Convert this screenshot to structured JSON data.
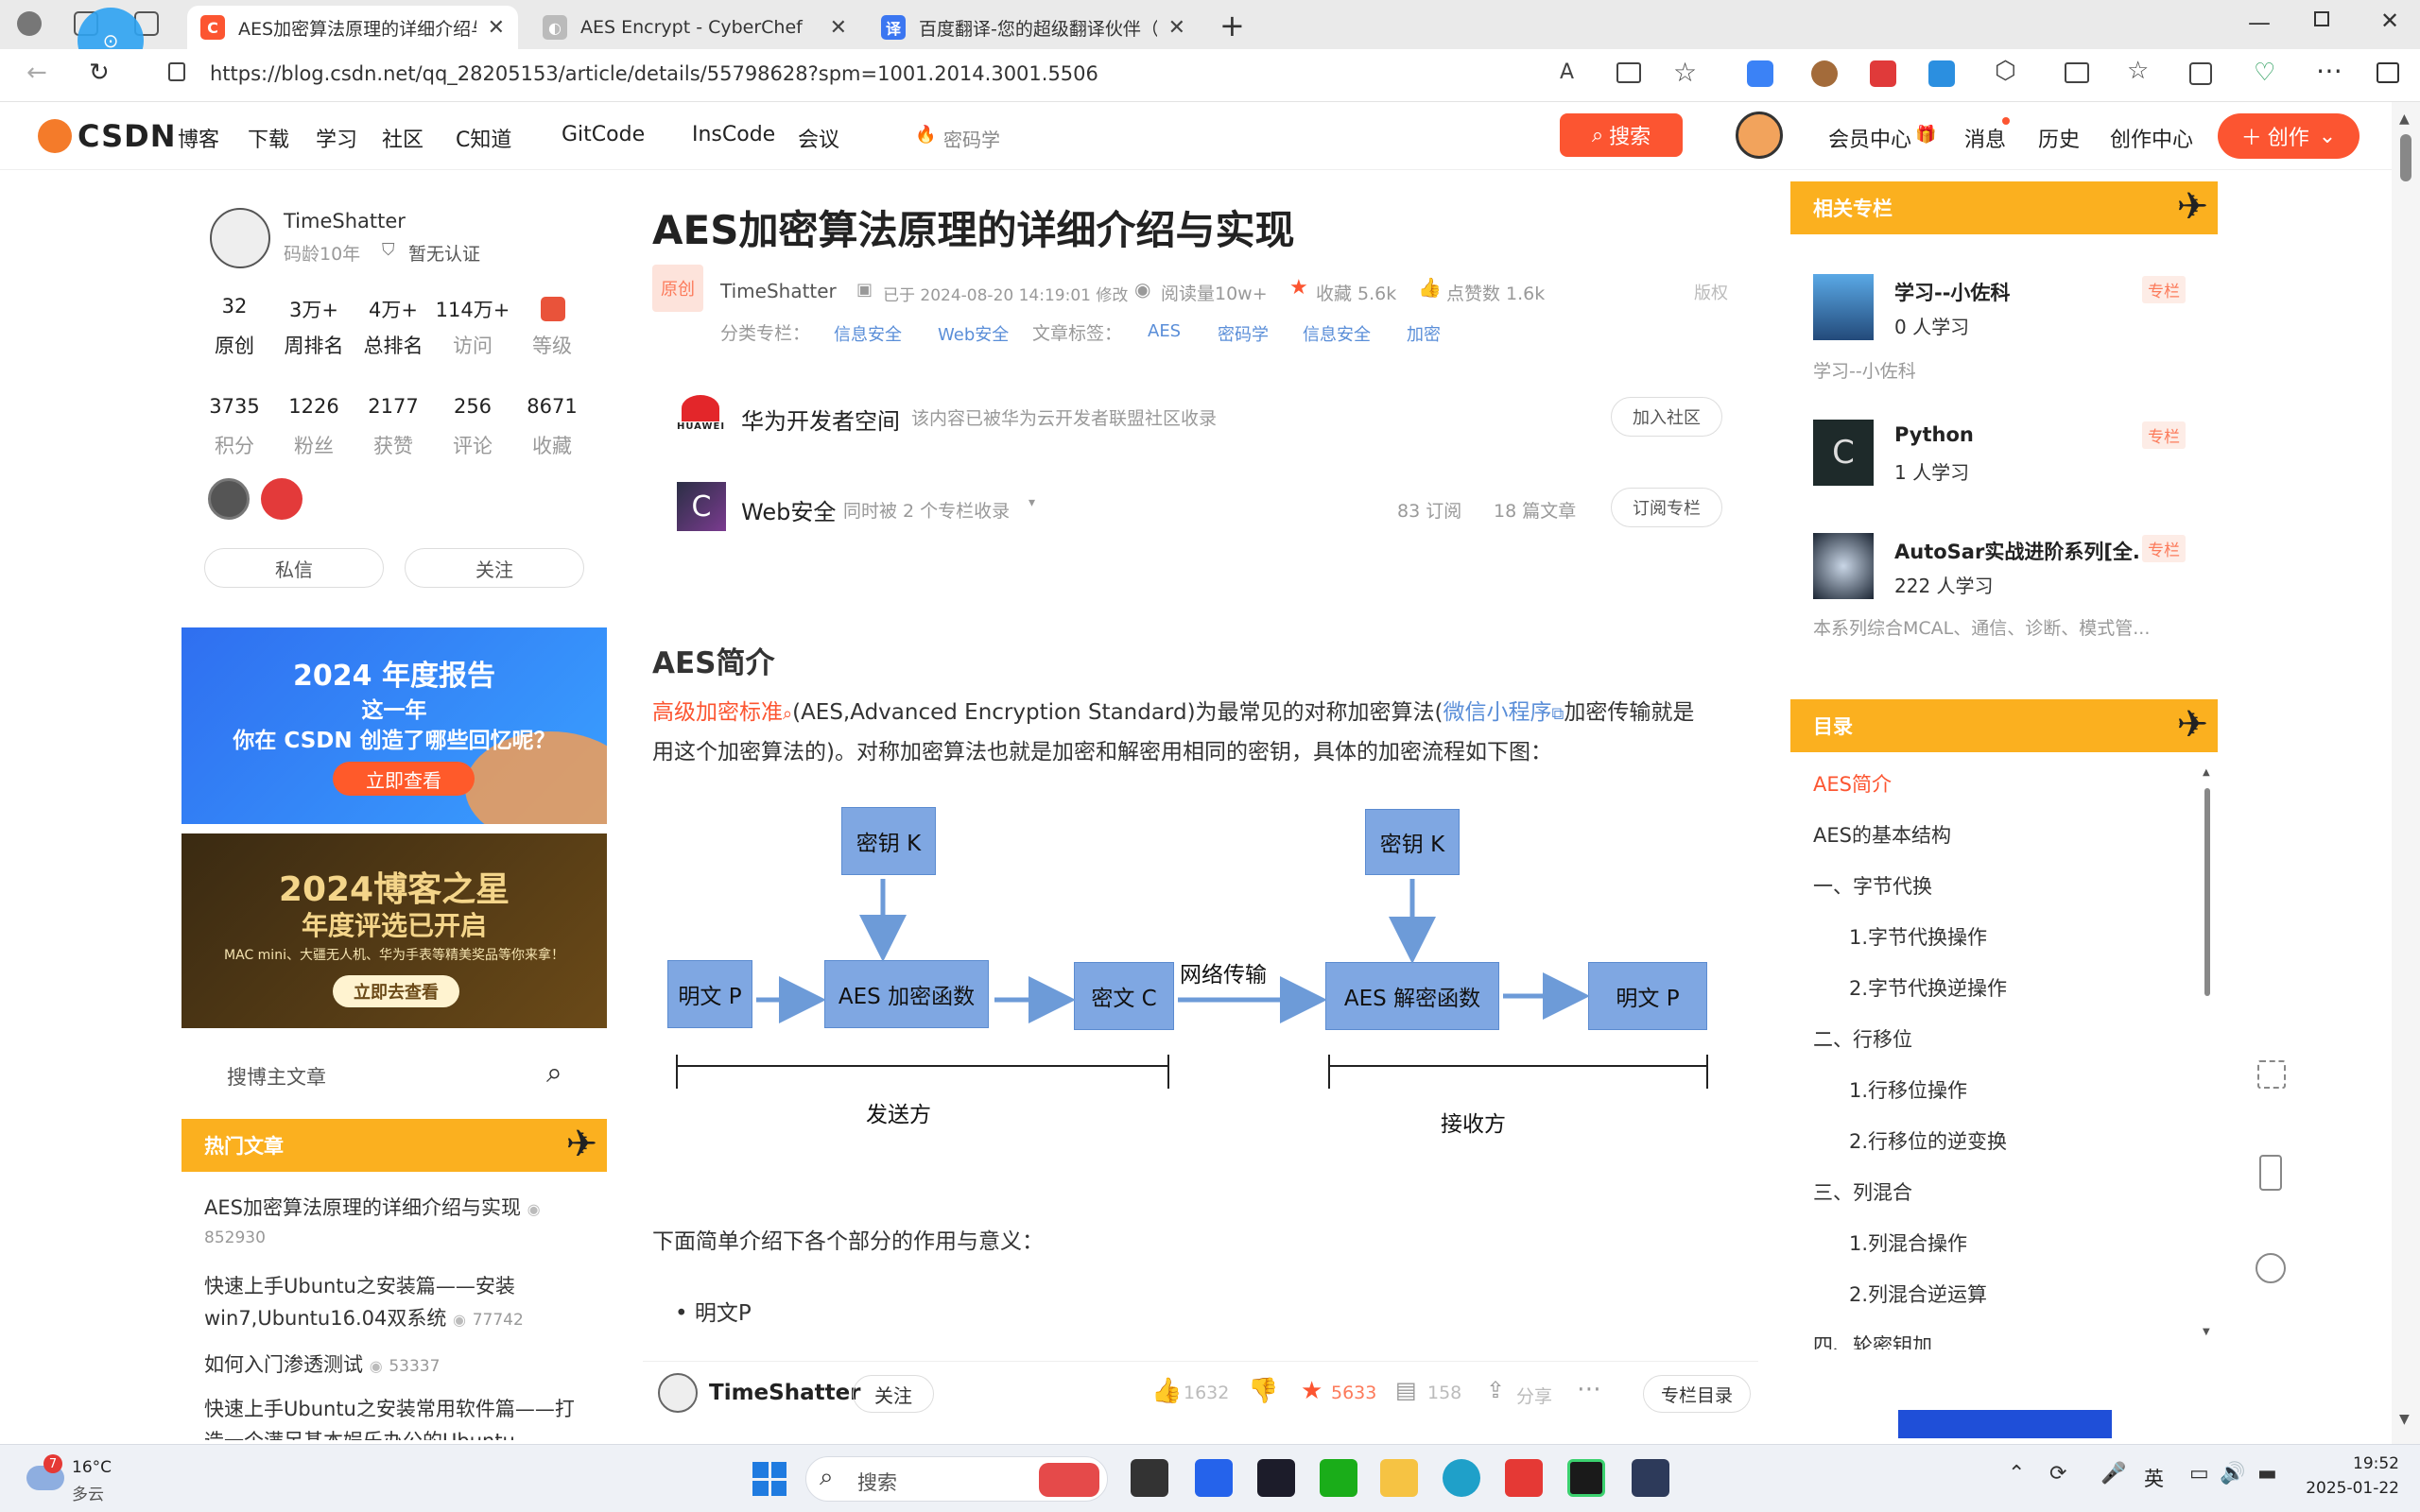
{
  "browser": {
    "tabs": [
      {
        "title": "AES加密算法原理的详细介绍与实",
        "icon": "C",
        "color": "#fc5531"
      },
      {
        "title": "AES Encrypt - CyberChef",
        "icon": "◐",
        "color": "#aaa"
      },
      {
        "title": "百度翻译-您的超级翻译伙伴（文",
        "icon": "译",
        "color": "#3b76f1"
      }
    ],
    "url": "https://blog.csdn.net/qq_28205153/article/details/55798628?spm=1001.2014.3001.5506"
  },
  "nav": {
    "logo": "CSDN",
    "items": [
      "博客",
      "下载",
      "学习",
      "社区",
      "C知道",
      "GitCode",
      "InsCode",
      "会议"
    ],
    "search_placeholder": "密码学",
    "search_button": "搜索",
    "right_items": [
      "会员中心",
      "消息",
      "历史",
      "创作中心"
    ],
    "create_button": "创作"
  },
  "author": {
    "name": "TimeShatter",
    "age": "码龄10年",
    "cert": "暂无认证",
    "stats1": [
      {
        "num": "32",
        "label": "原创"
      },
      {
        "num": "3万+",
        "label": "周排名"
      },
      {
        "num": "4万+",
        "label": "总排名"
      },
      {
        "num": "114万+",
        "label": "访问"
      },
      {
        "num": "",
        "label": "等级"
      }
    ],
    "stats2": [
      {
        "num": "3735",
        "label": "积分"
      },
      {
        "num": "1226",
        "label": "粉丝"
      },
      {
        "num": "2177",
        "label": "获赞"
      },
      {
        "num": "256",
        "label": "评论"
      },
      {
        "num": "8671",
        "label": "收藏"
      }
    ],
    "message_button": "私信",
    "follow_button": "关注"
  },
  "banners": {
    "report_line1": "2024 年度报告",
    "report_line2": "这一年",
    "report_line3": "你在 CSDN 创造了哪些回忆呢？",
    "report_btn": "立即查看",
    "star_line1": "2024博客之星",
    "star_line2": "年度评选已开启",
    "star_line3": "MAC mini、大疆无人机、华为手表等精美奖品等你来拿！",
    "star_btn": "立即去查看"
  },
  "blog_search_placeholder": "搜博主文章",
  "hot": {
    "title": "热门文章",
    "items": [
      {
        "title": "AES加密算法原理的详细介绍与实现",
        "views": "852930"
      },
      {
        "title": "快速上手Ubuntu之安装篇——安装win7,Ubuntu16.04双系统",
        "views": "77742"
      },
      {
        "title": "如何入门渗透测试",
        "views": "53337"
      },
      {
        "title": "快速上手Ubuntu之安装常用软件篇——打造一个满足基本娱乐办公的Ubuntu",
        "views": ""
      }
    ]
  },
  "article": {
    "title": "AES加密算法原理的详细介绍与实现",
    "badge": "原创",
    "author": "TimeShatter",
    "date": "已于 2024-08-20 14:19:01 修改",
    "reads": "阅读量10w+",
    "favs": "收藏 5.6k",
    "likes": "点赞数 1.6k",
    "copyright": "版权",
    "cat_label": "分类专栏：",
    "cats": [
      "信息安全",
      "Web安全"
    ],
    "tag_label": "文章标签：",
    "tags": [
      "AES",
      "密码学",
      "信息安全",
      "加密"
    ],
    "community_name": "华为开发者空间",
    "community_desc": "该内容已被华为云开发者联盟社区收录",
    "community_btn": "加入社区",
    "column_name": "Web安全",
    "column_desc": "同时被 2 个专栏收录",
    "column_subs": "83 订阅",
    "column_articles": "18 篇文章",
    "column_btn": "订阅专栏",
    "section1": "AES简介",
    "p1_link": "高级加密标准",
    "p1_a": "(AES,Advanced Encryption Standard)为最常见的对称加密算法(",
    "p1_link2": "微信小程序",
    "p1_b": "加密传输就是",
    "p1_c": "用这个加密算法的)。对称加密算法也就是加密和解密用相同的密钥，具体的加密流程如下图：",
    "p2": "下面简单介绍下各个部分的作用与意义：",
    "bullet1": "明文P"
  },
  "diagram": {
    "key1": "密钥 K",
    "key2": "密钥 K",
    "plain1": "明文 P",
    "enc": "AES 加密函数",
    "cipher": "密文  C",
    "net": "网络传输",
    "dec": "AES 解密函数",
    "plain2": "明文 P",
    "sender": "发送方",
    "receiver": "接收方"
  },
  "bottombar": {
    "author": "TimeShatter",
    "follow": "关注",
    "likes": "1632",
    "favs": "5633",
    "comments": "158",
    "share": "分享",
    "toc_btn": "专栏目录"
  },
  "related": {
    "title": "相关专栏",
    "items": [
      {
        "name": "学习--小佐科",
        "count": "0 人学习",
        "badge": "专栏"
      },
      {
        "name": "Python",
        "count": "1 人学习",
        "badge": "专栏"
      },
      {
        "name": "AutoSar实战进阶系列[全...",
        "count": "222 人学习",
        "badge": "专栏"
      }
    ],
    "desc1": "学习--小佐科",
    "desc3": "本系列综合MCAL、通信、诊断、模式管..."
  },
  "toc": {
    "title": "目录",
    "items": [
      "AES简介",
      "AES的基本结构",
      "一、字节代换",
      "1.字节代换操作",
      "2.字节代换逆操作",
      "二、行移位",
      "1.行移位操作",
      "2.行移位的逆变换",
      "三、列混合",
      "1.列混合操作",
      "2.列混合逆运算",
      "四、轮密钥加"
    ]
  },
  "taskbar": {
    "weather_temp": "16°C",
    "weather_desc": "多云",
    "weather_badge": "7",
    "search": "搜索",
    "lang": "英",
    "time": "19:52",
    "date": "2025-01-22"
  }
}
